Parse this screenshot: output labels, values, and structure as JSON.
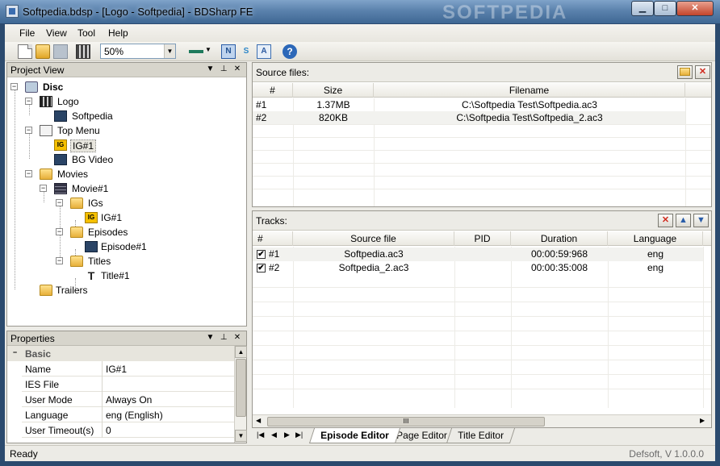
{
  "window": {
    "title": "Softpedia.bdsp - [Logo - Softpedia] - BDSharp FE",
    "watermark": "SOFTPEDIA",
    "controls": {
      "minimize": "▁",
      "maximize": "□",
      "close": "✕"
    }
  },
  "menu": {
    "items": [
      {
        "label": "File"
      },
      {
        "label": "View"
      },
      {
        "label": "Tool"
      },
      {
        "label": "Help"
      }
    ]
  },
  "toolbar": {
    "zoom_value": "50%",
    "icons": [
      "new-icon",
      "open-icon",
      "save-icon",
      "film-icon",
      "line-color-icon",
      "n-mode-icon",
      "s-mode-icon",
      "a-mode-icon",
      "help-icon"
    ],
    "n_label": "N",
    "s_label": "S",
    "a_label": "A",
    "help_label": "?"
  },
  "project_view": {
    "title": "Project View",
    "tree": [
      {
        "label": "Disc",
        "icon": "disc-icon"
      },
      {
        "label": "Logo",
        "icon": "clapper-icon"
      },
      {
        "label": "Softpedia",
        "icon": "video-icon"
      },
      {
        "label": "Top Menu",
        "icon": "menu-icon"
      },
      {
        "label": "IG#1",
        "icon": "ig-icon",
        "selected": true
      },
      {
        "label": "BG Video",
        "icon": "video-icon"
      },
      {
        "label": "Movies",
        "icon": "folder-icon"
      },
      {
        "label": "Movie#1",
        "icon": "movie-icon"
      },
      {
        "label": "IGs",
        "icon": "folder-icon"
      },
      {
        "label": "IG#1",
        "icon": "ig-icon"
      },
      {
        "label": "Episodes",
        "icon": "folder-icon"
      },
      {
        "label": "Episode#1",
        "icon": "video-icon"
      },
      {
        "label": "Titles",
        "icon": "folder-icon"
      },
      {
        "label": "Title#1",
        "icon": "title-icon"
      },
      {
        "label": "Trailers",
        "icon": "folder-icon"
      }
    ]
  },
  "properties": {
    "title": "Properties",
    "category": "Basic",
    "rows": [
      {
        "key": "Name",
        "value": "IG#1"
      },
      {
        "key": "IES File",
        "value": ""
      },
      {
        "key": "User Mode",
        "value": "Always On"
      },
      {
        "key": "Language",
        "value": "eng (English)"
      },
      {
        "key": "User Timeout(s)",
        "value": "0"
      }
    ]
  },
  "source_files": {
    "title": "Source files:",
    "columns": [
      "#",
      "Size",
      "Filename"
    ],
    "rows": [
      {
        "num": "#1",
        "size": "1.37MB",
        "filename": "C:\\Softpedia Test\\Softpedia.ac3"
      },
      {
        "num": "#2",
        "size": "820KB",
        "filename": "C:\\Softpedia Test\\Softpedia_2.ac3"
      }
    ]
  },
  "tracks": {
    "title": "Tracks:",
    "columns": [
      "#",
      "Source file",
      "PID",
      "Duration",
      "Language"
    ],
    "rows": [
      {
        "num": "#1",
        "checked": true,
        "source": "Softpedia.ac3",
        "pid": "",
        "duration": "00:00:59:968",
        "language": "eng"
      },
      {
        "num": "#2",
        "checked": true,
        "source": "Softpedia_2.ac3",
        "pid": "",
        "duration": "00:00:35:008",
        "language": "eng"
      }
    ]
  },
  "tabs": [
    {
      "label": "Episode Editor",
      "active": true
    },
    {
      "label": "Page Editor"
    },
    {
      "label": "Title Editor"
    }
  ],
  "status": {
    "left": "Ready",
    "right": "Defsoft, V 1.0.0.0"
  },
  "glyphs": {
    "checkmark": "✔",
    "expand_minus": "−",
    "dropdown": "▼",
    "pin": "⊥",
    "close": "✕",
    "scroll_up": "▲",
    "scroll_down": "▼",
    "scroll_left": "◀",
    "scroll_right": "▶",
    "grip": "III",
    "nav_first": "|◀",
    "nav_prev": "◀",
    "nav_next": "▶",
    "nav_last": "▶|"
  },
  "colors": {
    "accent": "#3b6db0",
    "titlebar": "#5b82ad",
    "panel_header": "#d7d5cc",
    "delete_red": "#d02a1d"
  }
}
